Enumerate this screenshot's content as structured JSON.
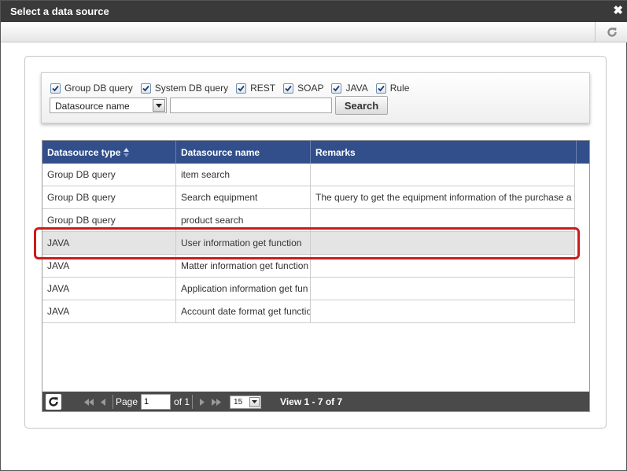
{
  "dialog": {
    "title": "Select a data source",
    "close_glyph": "✖"
  },
  "toolbar": {
    "refresh_icon": "refresh-icon"
  },
  "search": {
    "filters": [
      {
        "label": "Group DB query",
        "checked": true
      },
      {
        "label": "System DB query",
        "checked": true
      },
      {
        "label": "REST",
        "checked": true
      },
      {
        "label": "SOAP",
        "checked": true
      },
      {
        "label": "JAVA",
        "checked": true
      },
      {
        "label": "Rule",
        "checked": true
      }
    ],
    "field_select": "Datasource name",
    "input_value": "",
    "button_label": "Search"
  },
  "grid": {
    "columns": [
      "Datasource type",
      "Datasource name",
      "Remarks"
    ],
    "rows": [
      {
        "type": "Group DB query",
        "name": "item search",
        "remarks": "",
        "selected": false
      },
      {
        "type": "Group DB query",
        "name": "Search equipment",
        "remarks": "The query to get the equipment information of the purchase a",
        "selected": false
      },
      {
        "type": "Group DB query",
        "name": "product search",
        "remarks": "",
        "selected": false
      },
      {
        "type": "JAVA",
        "name": "User information get function",
        "remarks": "",
        "selected": true
      },
      {
        "type": "JAVA",
        "name": "Matter information get function",
        "remarks": "",
        "selected": false
      },
      {
        "type": "JAVA",
        "name": "Application information get fun",
        "remarks": "",
        "selected": false
      },
      {
        "type": "JAVA",
        "name": "Account date format get functio",
        "remarks": "",
        "selected": false
      }
    ]
  },
  "pager": {
    "page_label": "Page",
    "page_value": "1",
    "of_label": "of 1",
    "rows_per_page": "15",
    "view_text": "View 1 - 7 of 7"
  },
  "colors": {
    "title_bar": "#3a3a3a",
    "grid_header": "#324f8b",
    "pager_bar": "#4a4a4a",
    "highlight": "#cc1b1b",
    "selected_row": "#e4e4e4"
  }
}
